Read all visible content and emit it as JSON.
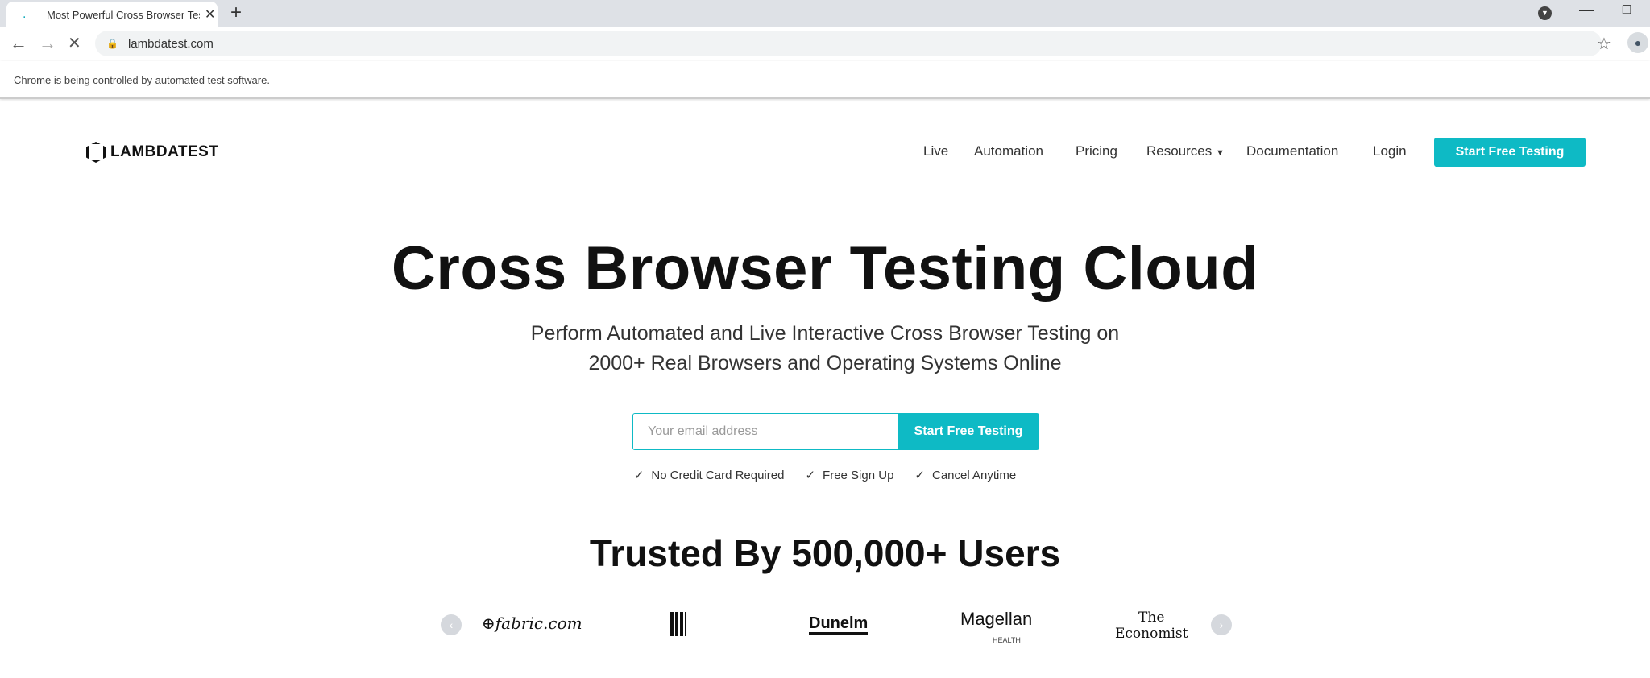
{
  "browser": {
    "tab_title": "Most Powerful Cross Browser Testing",
    "url": "lambdatest.com",
    "info_bar": "Chrome is being controlled by automated test software."
  },
  "header": {
    "logo": "LAMBDATEST",
    "nav": [
      "Live",
      "Automation",
      "Pricing",
      "Resources",
      "Documentation",
      "Login"
    ],
    "cta": "Start Free Testing"
  },
  "hero": {
    "title": "Cross Browser Testing Cloud",
    "subtitle_line1": "Perform Automated and Live Interactive Cross Browser Testing on",
    "subtitle_line2": "2000+ Real Browsers and Operating Systems Online",
    "email_placeholder": "Your email address",
    "email_button": "Start Free Testing",
    "checks": [
      "No Credit Card Required",
      "Free Sign Up",
      "Cancel Anytime"
    ]
  },
  "trusted": {
    "title": "Trusted By 500,000+ Users",
    "logos": [
      "fabric.com",
      "Dunelm",
      "Magellan",
      "HEALTH",
      "The",
      "Economist"
    ]
  },
  "colors": {
    "accent": "#0ebac5"
  }
}
